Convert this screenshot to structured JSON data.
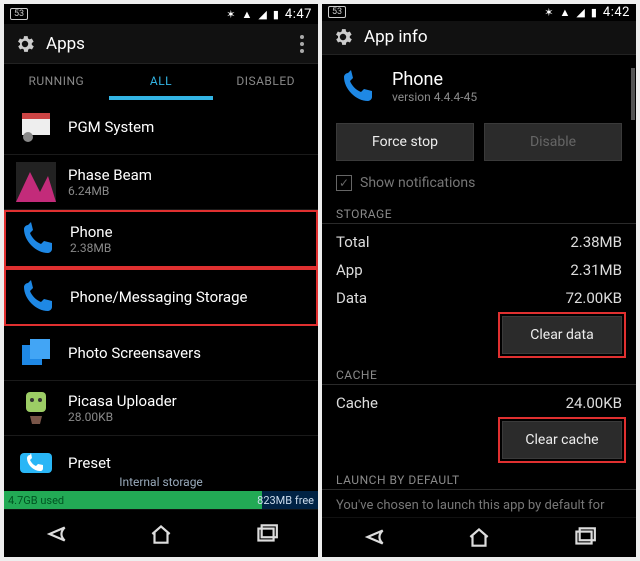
{
  "left": {
    "status": {
      "battery_pct": "53",
      "clock": "4:47"
    },
    "action": {
      "title": "Apps"
    },
    "tabs": {
      "running": "RUNNING",
      "all": "ALL",
      "disabled": "DISABLED"
    },
    "apps": [
      {
        "name": "PGM System",
        "sub": ""
      },
      {
        "name": "Phase Beam",
        "sub": "6.24MB"
      },
      {
        "name": "Phone",
        "sub": "2.38MB"
      },
      {
        "name": "Phone/Messaging Storage",
        "sub": ""
      },
      {
        "name": "Photo Screensavers",
        "sub": ""
      },
      {
        "name": "Picasa Uploader",
        "sub": "28.00KB"
      },
      {
        "name": "Preset",
        "sub": ""
      }
    ],
    "storage": {
      "label": "Internal storage",
      "used": "4.7GB used",
      "free": "823MB free"
    }
  },
  "right": {
    "status": {
      "battery_pct": "53",
      "clock": "4:42"
    },
    "action": {
      "title": "App info"
    },
    "head": {
      "name": "Phone",
      "version": "version 4.4.4-45"
    },
    "buttons": {
      "force_stop": "Force stop",
      "disable": "Disable"
    },
    "show_notifications": "Show notifications",
    "sections": {
      "storage": "STORAGE",
      "cache": "CACHE",
      "launch": "LAUNCH BY DEFAULT"
    },
    "storage": {
      "total_k": "Total",
      "total_v": "2.38MB",
      "app_k": "App",
      "app_v": "2.31MB",
      "data_k": "Data",
      "data_v": "72.00KB",
      "clear_data": "Clear data"
    },
    "cache": {
      "cache_k": "Cache",
      "cache_v": "24.00KB",
      "clear_cache": "Clear cache"
    },
    "launch_text": "You've chosen to launch this app by default for"
  }
}
